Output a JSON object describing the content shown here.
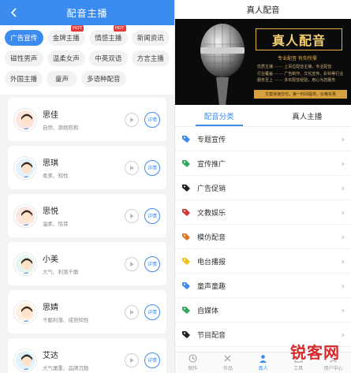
{
  "left": {
    "title": "配音主播",
    "chip_rows": [
      [
        {
          "label": "广告宣传",
          "active": true,
          "hot": ""
        },
        {
          "label": "金牌主播",
          "active": false,
          "hot": "HOT"
        },
        {
          "label": "情感主播",
          "active": false,
          "hot": "HOT"
        },
        {
          "label": "新闻资讯",
          "active": false,
          "hot": ""
        }
      ],
      [
        {
          "label": "磁性男声",
          "active": false,
          "hot": ""
        },
        {
          "label": "温柔女声",
          "active": false,
          "hot": ""
        },
        {
          "label": "中英双语",
          "active": false,
          "hot": ""
        },
        {
          "label": "方言主播",
          "active": false,
          "hot": ""
        }
      ],
      [
        {
          "label": "外国主播",
          "active": false,
          "hot": ""
        },
        {
          "label": "童声",
          "active": false,
          "hot": ""
        },
        {
          "label": "多语种配音",
          "active": false,
          "hot": ""
        }
      ]
    ],
    "anchors": [
      {
        "name": "思佳",
        "desc": "自然、源频陪和",
        "detail": "详情",
        "gender": "f"
      },
      {
        "name": "思琪",
        "desc": "柔美、知性",
        "detail": "详情",
        "gender": "f"
      },
      {
        "name": "思悦",
        "desc": "温柔、恬耳",
        "detail": "详情",
        "gender": "f"
      },
      {
        "name": "小美",
        "desc": "大气、利落干脆",
        "detail": "详情",
        "gender": "f"
      },
      {
        "name": "思婧",
        "desc": "干脆利落、成熟知性",
        "detail": "详情",
        "gender": "f"
      },
      {
        "name": "艾达",
        "desc": "大气庸重、品牌沉稳",
        "detail": "详情",
        "gender": "m"
      }
    ]
  },
  "right": {
    "title": "真人配音",
    "banner": {
      "title": "真人配音",
      "subtitle": "专业配音  有你所需",
      "lines": [
        "优质主播 ·······  上百位配音主播，专业配音",
        "行业覆盖 ·······  广告制作、文化宣传、彩铃等行业",
        "服务至上 ·······  多年配音经验，用心为您服务"
      ],
      "bar": "文案快速交付，第一时间提供，价格实惠"
    },
    "tabs": [
      {
        "label": "配音分类",
        "active": true
      },
      {
        "label": "真人主播",
        "active": false
      }
    ],
    "categories": [
      {
        "label": "专题宣传",
        "color": "#3c8cf0"
      },
      {
        "label": "宣传推广",
        "color": "#2eaa5a"
      },
      {
        "label": "广告促销",
        "color": "#222222"
      },
      {
        "label": "文教娱乐",
        "color": "#d23a3a"
      },
      {
        "label": "模仿配音",
        "color": "#e07a22"
      },
      {
        "label": "电台播报",
        "color": "#f0c419"
      },
      {
        "label": "童声童趣",
        "color": "#3c8cf0"
      },
      {
        "label": "自媒体",
        "color": "#2eaa5a"
      },
      {
        "label": "节目配音",
        "color": "#222222"
      }
    ],
    "nav": [
      {
        "label": "制作",
        "icon": "clock-icon",
        "active": false
      },
      {
        "label": "作品",
        "icon": "tools-icon",
        "active": false
      },
      {
        "label": "真人",
        "icon": "person-icon",
        "active": true
      },
      {
        "label": "工具",
        "icon": "toolbox-icon",
        "active": false
      },
      {
        "label": "用户中心",
        "icon": "user-icon",
        "active": false
      }
    ],
    "watermark": "锐客网"
  }
}
